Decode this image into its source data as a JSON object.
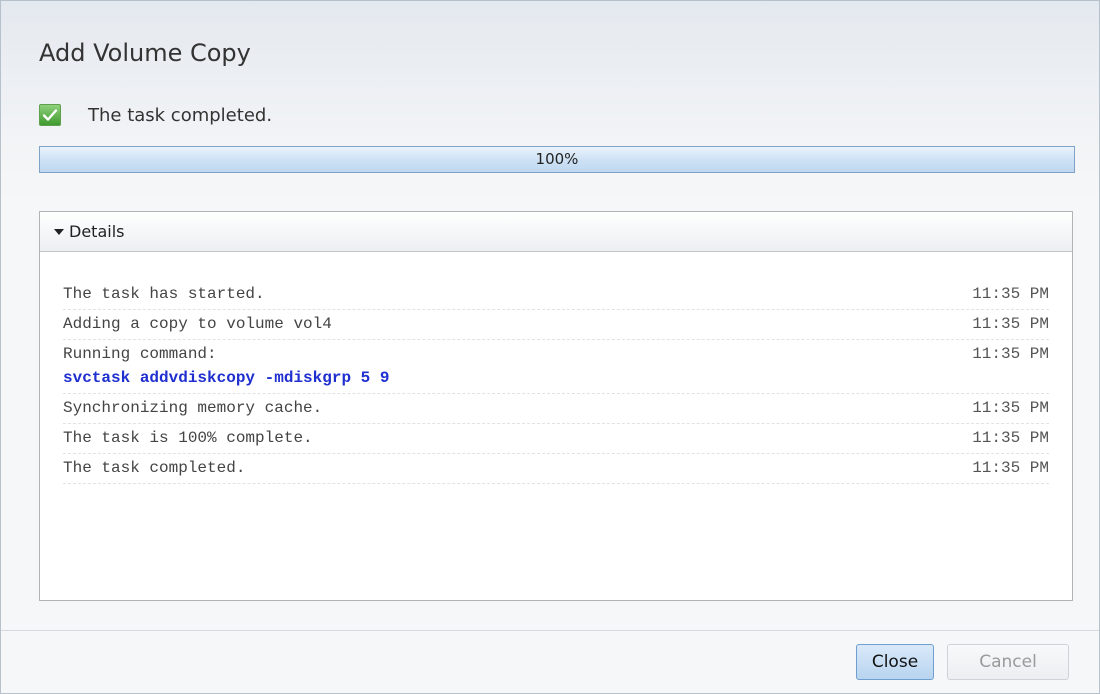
{
  "dialog": {
    "title": "Add Volume Copy",
    "status_text": "The task completed.",
    "progress": {
      "value": 100,
      "label": "100%"
    }
  },
  "details": {
    "header_label": "Details",
    "expanded": true,
    "log": [
      {
        "message": "The task has started.",
        "time": "11:35 PM"
      },
      {
        "message": "Adding a copy to volume vol4",
        "time": "11:35 PM"
      },
      {
        "message": "Running command:",
        "command": "svctask addvdiskcopy -mdiskgrp 5 9",
        "time": "11:35 PM"
      },
      {
        "message": "Synchronizing memory cache.",
        "time": "11:35 PM"
      },
      {
        "message": "The task is 100% complete.",
        "time": "11:35 PM"
      },
      {
        "message": "The task completed.",
        "time": "11:35 PM"
      }
    ]
  },
  "buttons": {
    "close_label": "Close",
    "cancel_label": "Cancel"
  },
  "icons": {
    "status": "checkmark-icon",
    "expand": "triangle-down-icon"
  },
  "colors": {
    "command_text": "#1f2fd0",
    "success_green": "#3f9a2f",
    "progress_fill": "#cfe2f5"
  }
}
